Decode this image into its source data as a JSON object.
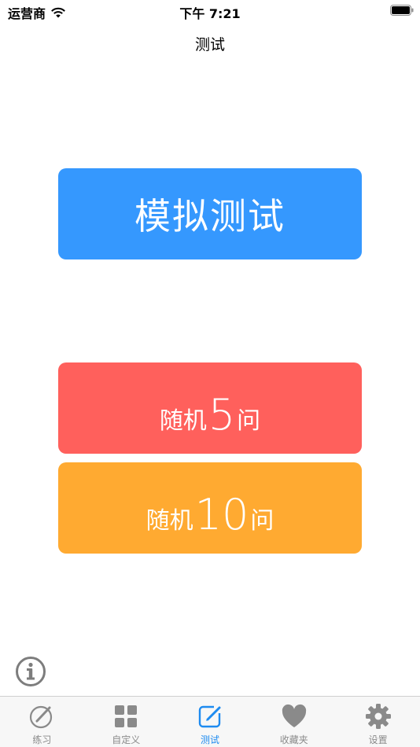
{
  "status_bar": {
    "carrier": "运营商",
    "time": "下午 7:21"
  },
  "nav": {
    "title": "测试"
  },
  "buttons": {
    "mock_test": "模拟测试",
    "random5": {
      "prefix": "随机",
      "number": "5",
      "suffix": "问"
    },
    "random10": {
      "prefix": "随机",
      "number": "10",
      "suffix": "问"
    }
  },
  "tabs": [
    {
      "label": "练习",
      "icon": "pencil-circle-icon"
    },
    {
      "label": "自定义",
      "icon": "grid-icon"
    },
    {
      "label": "测试",
      "icon": "edit-square-icon",
      "active": true
    },
    {
      "label": "收藏夹",
      "icon": "heart-icon"
    },
    {
      "label": "设置",
      "icon": "gear-icon"
    }
  ],
  "colors": {
    "mock_test": "#3598FE",
    "random5": "#FF605C",
    "random10": "#FFAA31",
    "tab_active": "#1E8BF0",
    "tab_inactive": "#8a8a8a"
  }
}
